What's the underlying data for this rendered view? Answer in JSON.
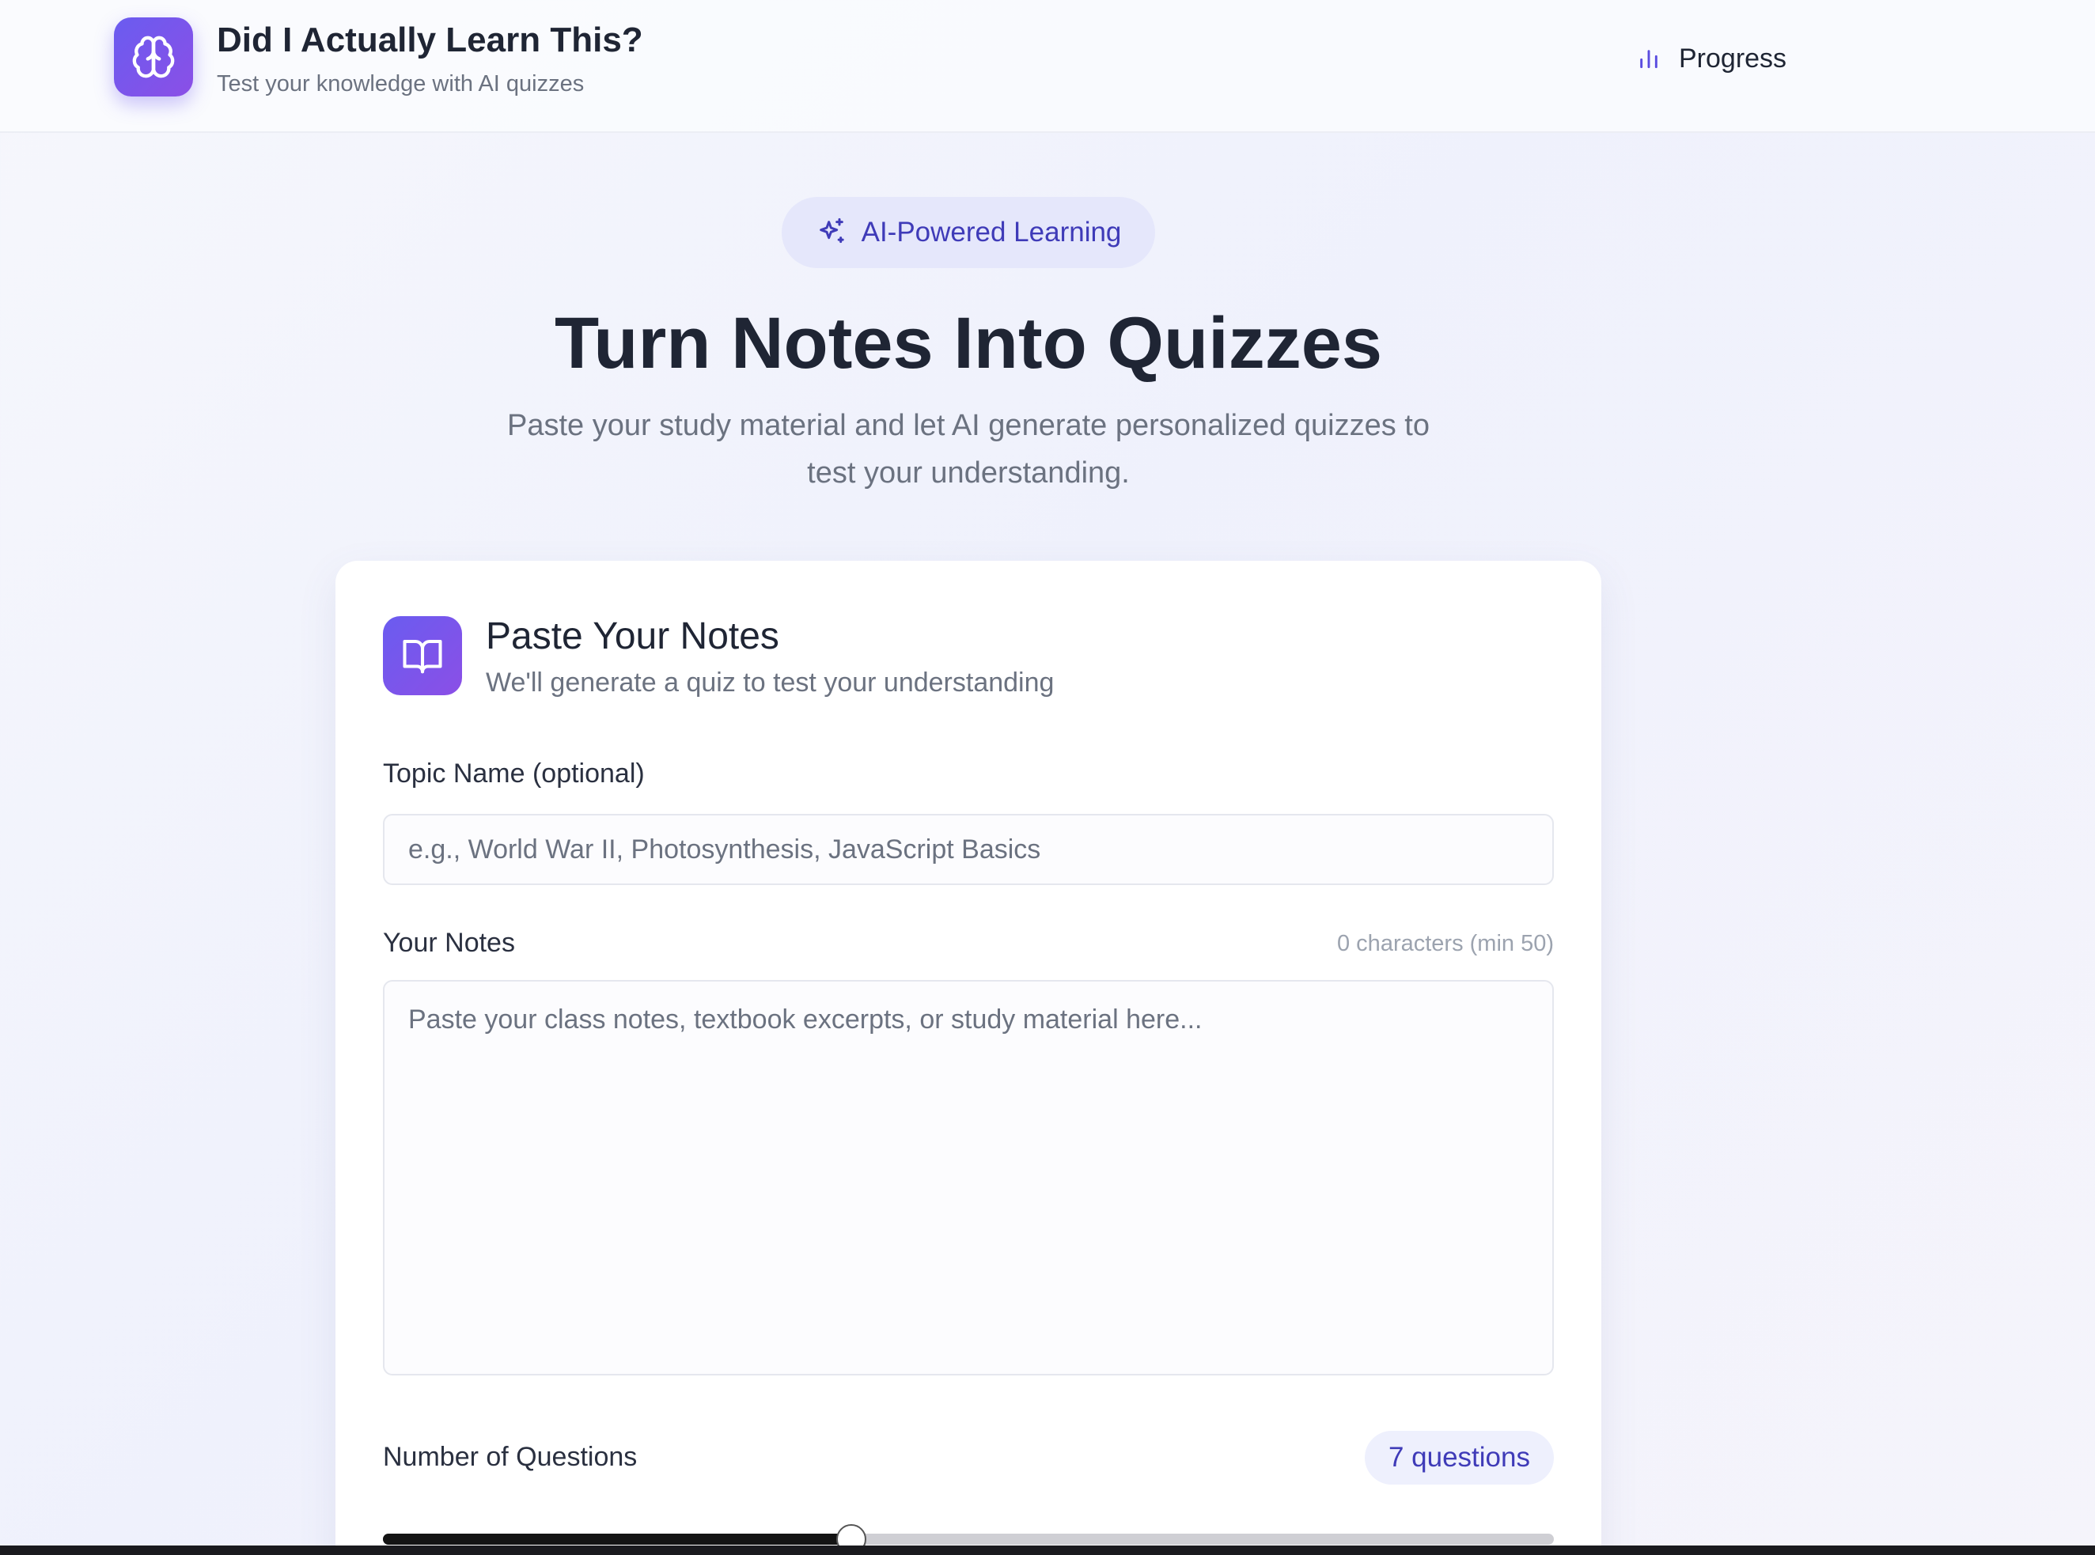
{
  "app": {
    "title": "Did I Actually Learn This?",
    "subtitle": "Test your knowledge with AI quizzes",
    "logo_icon": "brain-icon"
  },
  "nav": {
    "progress_label": "Progress",
    "progress_icon": "bar-chart-icon"
  },
  "hero": {
    "badge_label": "AI-Powered Learning",
    "badge_icon": "sparkles-icon",
    "title": "Turn Notes Into Quizzes",
    "subtitle": "Paste your study material and let AI generate personalized quizzes to test your understanding."
  },
  "card": {
    "icon": "book-open-icon",
    "title": "Paste Your Notes",
    "subtitle": "We'll generate a quiz to test your understanding",
    "topic": {
      "label": "Topic Name (optional)",
      "value": "",
      "placeholder": "e.g., World War II, Photosynthesis, JavaScript Basics"
    },
    "notes": {
      "label": "Your Notes",
      "value": "",
      "placeholder": "Paste your class notes, textbook excerpts, or study material here...",
      "char_count": "0 characters (min 50)"
    },
    "questions": {
      "label": "Number of Questions",
      "badge": "7 questions",
      "slider_value_percent": 40
    }
  },
  "colors": {
    "accent": "#6a5cf0",
    "accent_text": "#3f3bb8",
    "badge_bg": "#e5e7fb"
  }
}
